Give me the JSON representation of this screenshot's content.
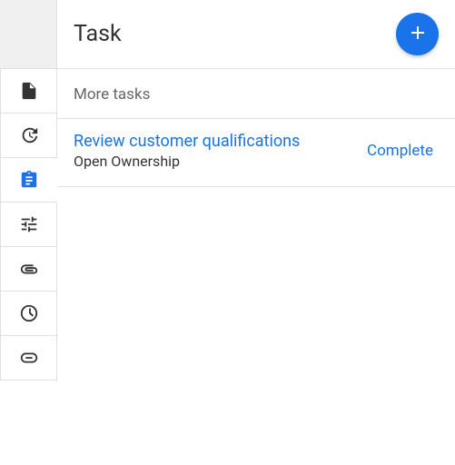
{
  "header": {
    "title": "Task",
    "add_icon": "plus-icon"
  },
  "section": {
    "label": "More tasks"
  },
  "tasks": [
    {
      "title": "Review customer qualifications",
      "subtitle": "Open Ownership",
      "action": "Complete"
    }
  ],
  "sidebar": {
    "items": [
      {
        "icon": "file-icon",
        "active": false
      },
      {
        "icon": "history-icon",
        "active": false
      },
      {
        "icon": "clipboard-icon",
        "active": true
      },
      {
        "icon": "tune-icon",
        "active": false
      },
      {
        "icon": "attachment-icon",
        "active": false
      },
      {
        "icon": "clock-icon",
        "active": false
      },
      {
        "icon": "link-icon",
        "active": false
      }
    ]
  }
}
